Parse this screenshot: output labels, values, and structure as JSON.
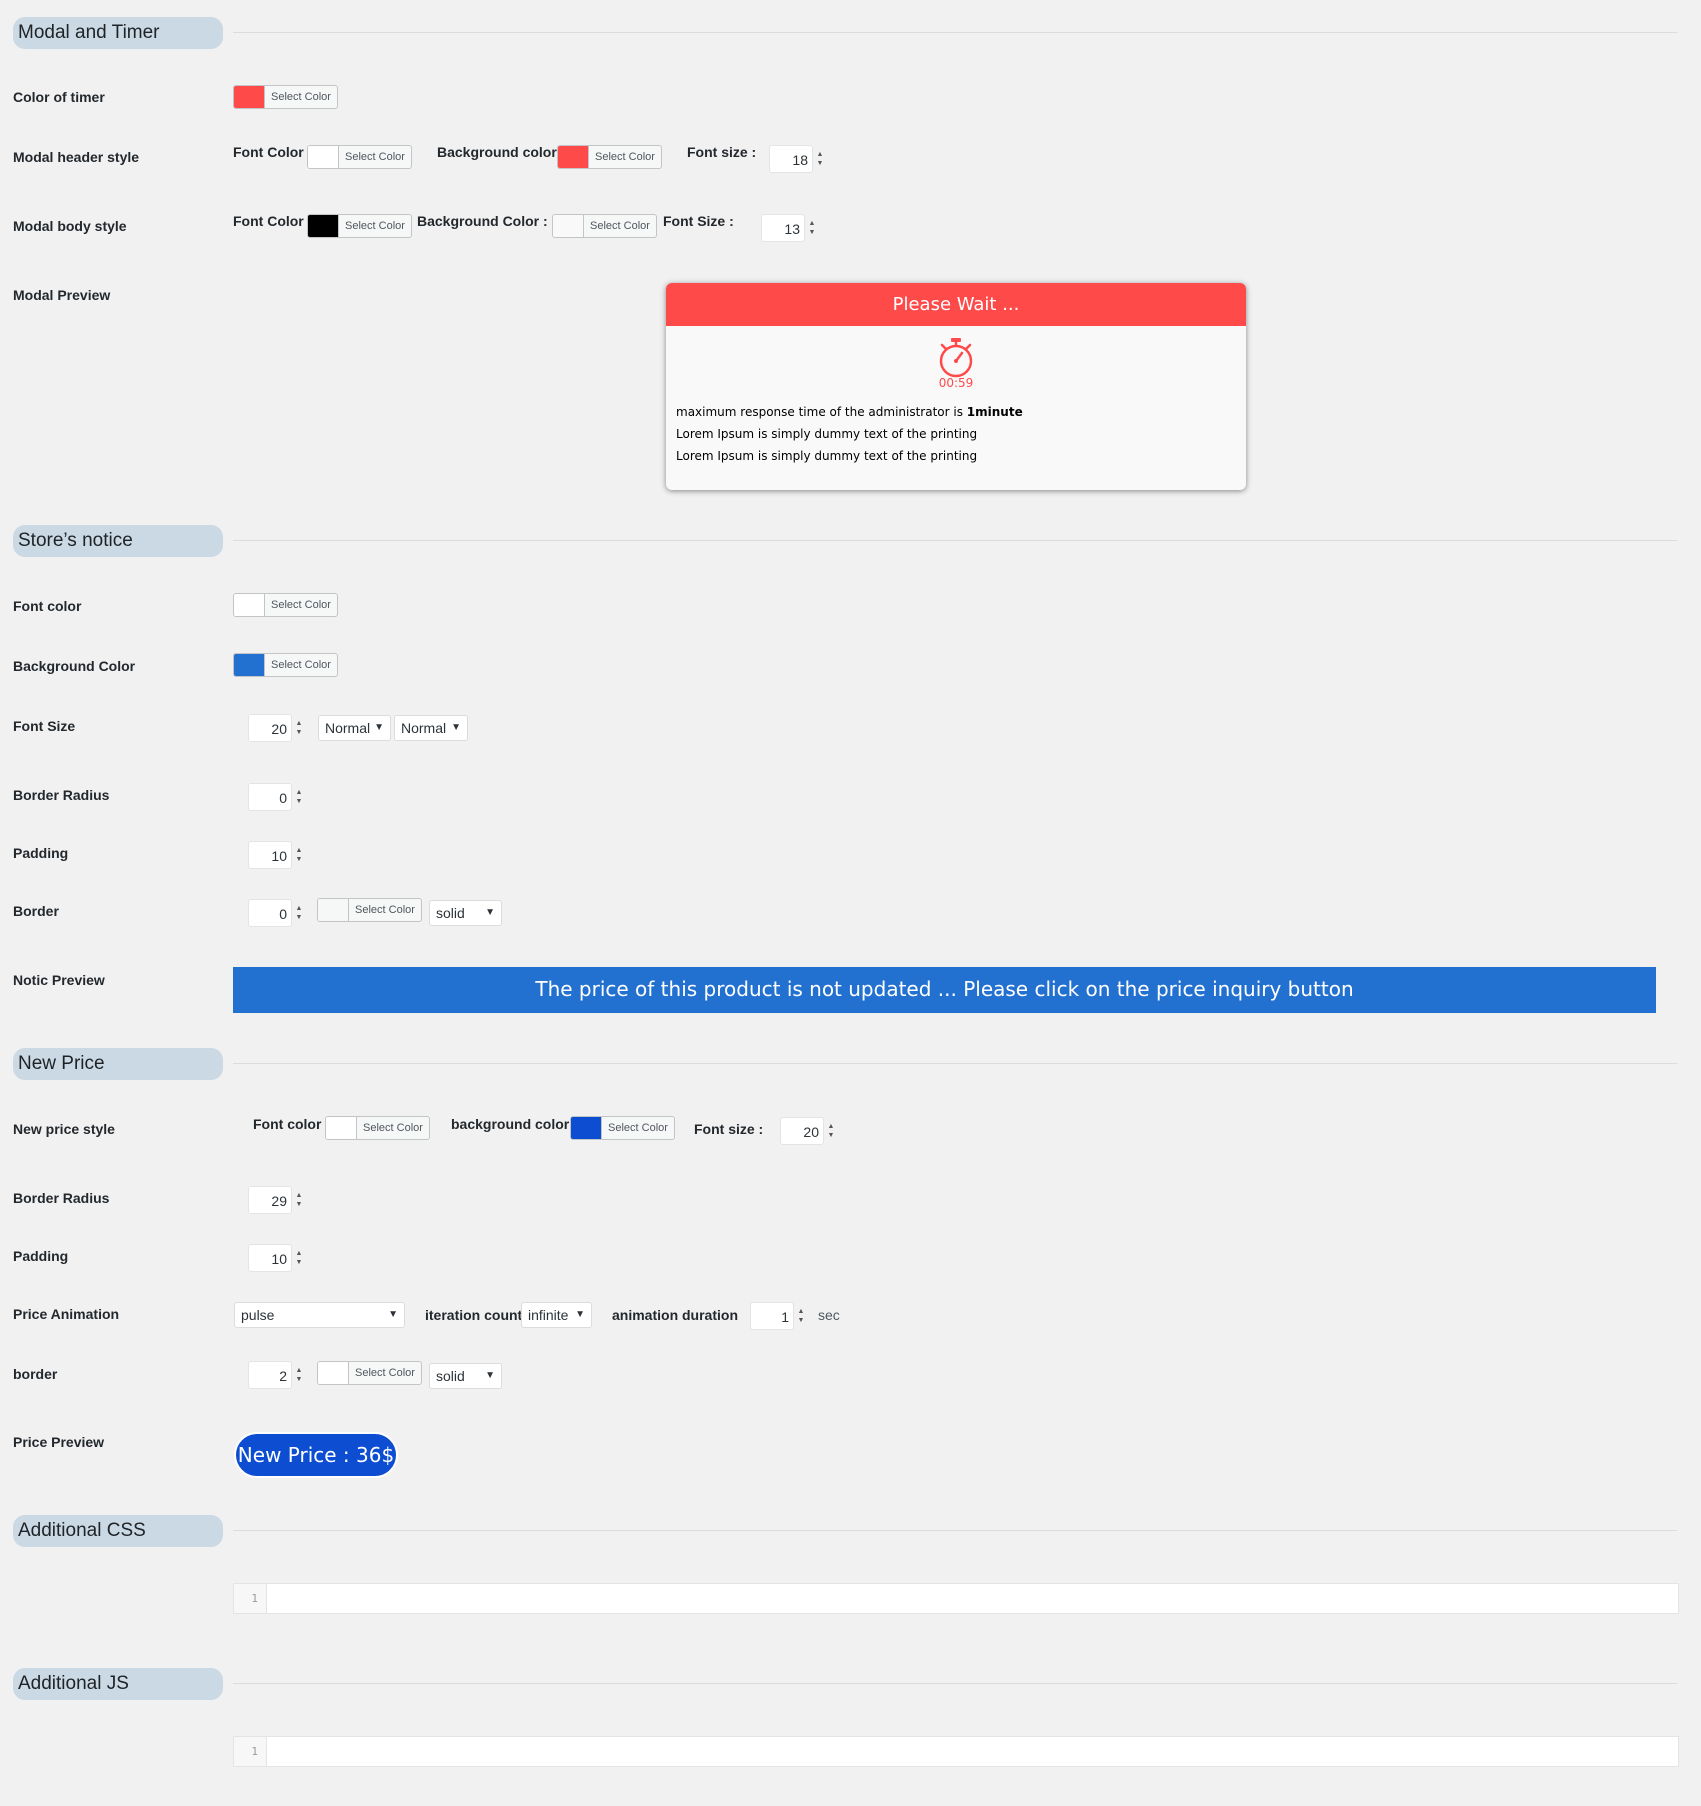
{
  "sections": {
    "modal_timer": "Modal and Timer",
    "store_notice": "Store’s notice",
    "new_price": "New Price",
    "additional_css": "Additional CSS",
    "additional_js": "Additional JS"
  },
  "common": {
    "select_color": "Select Color"
  },
  "modal_timer": {
    "color_of_timer_label": "Color of timer",
    "timer_color": "#ff4a4a",
    "header_style_label": "Modal header style",
    "header_font_color_label": "Font Color :",
    "header_font_color": "#ffffff",
    "header_bg_label": "Background color :",
    "header_bg_color": "#ff4a4a",
    "header_font_size_label": "Font size :",
    "header_font_size": "18",
    "body_style_label": "Modal body style",
    "body_font_color_label": "Font Color :",
    "body_font_color": "#000000",
    "body_bg_label": "Background Color :",
    "body_bg_color": "#f9f9f9",
    "body_font_size_label": "Font Size :",
    "body_font_size": "13",
    "preview_label": "Modal Preview",
    "preview": {
      "header": "Please Wait ...",
      "timer": "00:59",
      "line1_prefix": "maximum response time of the administrator is ",
      "line1_bold": "1minute",
      "line2": "Lorem Ipsum is simply dummy text of the printing",
      "line3": "Lorem Ipsum is simply dummy text of the printing"
    }
  },
  "store_notice": {
    "font_color_label": "Font color",
    "font_color": "#ffffff",
    "bg_color_label": "Background Color",
    "bg_color": "#2271d1",
    "font_size_label": "Font Size",
    "font_size": "20",
    "weight_select": "Normal",
    "style_select": "Normal",
    "border_radius_label": "Border Radius",
    "border_radius": "0",
    "padding_label": "Padding",
    "padding": "10",
    "border_label": "Border",
    "border_width": "0",
    "border_color": "#f6f7f7",
    "border_style": "solid",
    "preview_label": "Notic Preview",
    "preview_text": "The price of this product is not updated ... Please click on the price inquiry button"
  },
  "new_price": {
    "style_label": "New price style",
    "font_color_label": "Font color :",
    "font_color": "#ffffff",
    "bg_color_label": "background color :",
    "bg_color": "#0c4dd2",
    "font_size_label": "Font size :",
    "font_size": "20",
    "border_radius_label": "Border Radius",
    "border_radius": "29",
    "padding_label": "Padding",
    "padding": "10",
    "animation_label": "Price Animation",
    "animation": "pulse",
    "iteration_label": "iteration count",
    "iteration": "infinite",
    "duration_label": "animation duration",
    "duration": "1",
    "duration_unit": "sec",
    "border_label": "border",
    "border_width": "2",
    "border_color": "#ffffff",
    "border_style": "solid",
    "preview_label": "Price Preview",
    "preview_text": "New Price : 36$"
  },
  "additional_css": {
    "line_number": "1"
  },
  "additional_js": {
    "line_number": "1"
  }
}
